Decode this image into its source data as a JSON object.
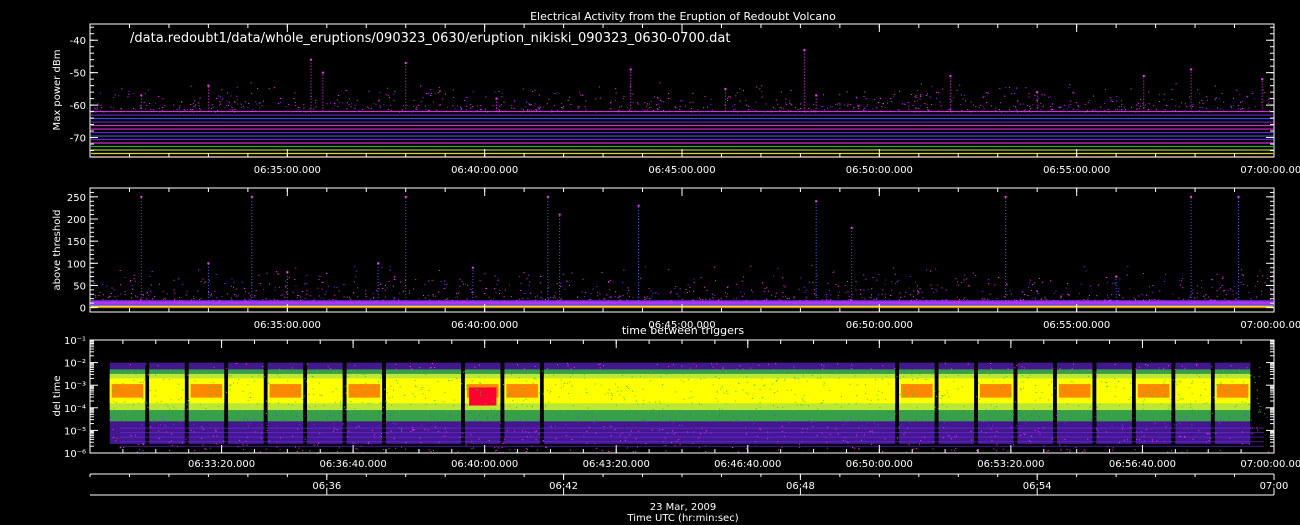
{
  "title": "Electrical Activity from the Eruption of Redoubt Volcano",
  "file_path": "/data.redoubt1/data/whole_eruptions/090323_0630/eruption_nikiski_090323_0630-0700.dat",
  "date_label": "23 Mar, 2009",
  "xaxis_title": "Time UTC (hr:min:sec)",
  "colors": {
    "background": "#000000",
    "axes": "#ffffff",
    "magenta": "#ff33ff",
    "purple": "#7a2cff",
    "blue": "#4466ff",
    "green": "#33cc33",
    "yellowgreen": "#ccee33",
    "yellow": "#ffff00",
    "orange": "#ff8800",
    "red": "#ff0033"
  },
  "chart_data": [
    {
      "type": "scatter",
      "title": "",
      "ylabel": "Max power dBm",
      "ylim": [
        -76,
        -35
      ],
      "y_ticks": [
        -40,
        -50,
        -60,
        -70
      ],
      "x_tick_labels": [
        "06:35:00.000",
        "06:40:00.000",
        "06:45:00.000",
        "06:50:00.000",
        "06:55:00.000",
        "07:00:00.000"
      ],
      "x_tick_minutes": [
        35,
        40,
        45,
        50,
        55,
        60
      ],
      "xlim_minutes": [
        30,
        60
      ],
      "baseline_range": [
        -76,
        -62
      ],
      "spikes": [
        {
          "t": 31.3,
          "y": -57
        },
        {
          "t": 33.0,
          "y": -54
        },
        {
          "t": 35.6,
          "y": -46
        },
        {
          "t": 35.9,
          "y": -50
        },
        {
          "t": 38.0,
          "y": -47
        },
        {
          "t": 40.3,
          "y": -58
        },
        {
          "t": 43.7,
          "y": -49
        },
        {
          "t": 46.1,
          "y": -55
        },
        {
          "t": 48.1,
          "y": -43
        },
        {
          "t": 48.4,
          "y": -57
        },
        {
          "t": 51.8,
          "y": -51
        },
        {
          "t": 54.0,
          "y": -56
        },
        {
          "t": 56.7,
          "y": -51
        },
        {
          "t": 57.9,
          "y": -49
        },
        {
          "t": 59.7,
          "y": -52
        }
      ]
    },
    {
      "type": "scatter",
      "ylabel": "above threshold",
      "ylim": [
        -10,
        270
      ],
      "y_ticks": [
        0,
        50,
        100,
        150,
        200,
        250
      ],
      "x_tick_labels": [
        "06:35:00.000",
        "06:40:00.000",
        "06:45:00.000",
        "06:50:00.000",
        "06:55:00.000",
        "07:00:00.000"
      ],
      "x_tick_minutes": [
        35,
        40,
        45,
        50,
        55,
        60
      ],
      "xlim_minutes": [
        30,
        60
      ],
      "baseline_range": [
        0,
        15
      ],
      "spikes": [
        {
          "t": 31.3,
          "y": 250
        },
        {
          "t": 33.0,
          "y": 100
        },
        {
          "t": 34.1,
          "y": 250
        },
        {
          "t": 35.0,
          "y": 80
        },
        {
          "t": 37.3,
          "y": 100
        },
        {
          "t": 38.0,
          "y": 250
        },
        {
          "t": 39.7,
          "y": 90
        },
        {
          "t": 41.6,
          "y": 250
        },
        {
          "t": 41.9,
          "y": 210
        },
        {
          "t": 43.9,
          "y": 230
        },
        {
          "t": 48.4,
          "y": 240
        },
        {
          "t": 49.3,
          "y": 180
        },
        {
          "t": 53.2,
          "y": 250
        },
        {
          "t": 56.0,
          "y": 70
        },
        {
          "t": 57.9,
          "y": 250
        },
        {
          "t": 59.1,
          "y": 250
        }
      ]
    },
    {
      "type": "scatter",
      "title": "time between triggers",
      "ylabel": "del time",
      "yscale": "log",
      "ylim": [
        1e-06,
        0.1
      ],
      "y_tick_labels": [
        "10⁻¹",
        "10⁻²",
        "10⁻³",
        "10⁻⁴",
        "10⁻⁵",
        "10⁻⁶"
      ],
      "y_tick_exponents": [
        -1,
        -2,
        -3,
        -4,
        -5,
        -6
      ],
      "x_tick_labels": [
        "06:33:20.000",
        "06:36:40.000",
        "06:40:00.000",
        "06:43:20.000",
        "06:46:40.000",
        "06:50:00.000",
        "06:53:20.000",
        "06:56:40.000",
        "07:00:00.000"
      ],
      "x_tick_minutes": [
        33.3333,
        36.6667,
        40.0,
        43.3333,
        46.6667,
        50.0,
        53.3333,
        56.6667,
        60.0
      ],
      "xlim_minutes": [
        30,
        60
      ],
      "blocks": [
        {
          "t0": 30.5,
          "t1": 31.4,
          "level": "orange"
        },
        {
          "t0": 31.5,
          "t1": 32.4,
          "level": "yellow"
        },
        {
          "t0": 32.5,
          "t1": 33.4,
          "level": "orange"
        },
        {
          "t0": 33.5,
          "t1": 34.4,
          "level": "yellow"
        },
        {
          "t0": 34.5,
          "t1": 35.4,
          "level": "orange"
        },
        {
          "t0": 35.5,
          "t1": 36.4,
          "level": "yellow"
        },
        {
          "t0": 36.5,
          "t1": 37.4,
          "level": "orange"
        },
        {
          "t0": 37.5,
          "t1": 39.4,
          "level": "yellow"
        },
        {
          "t0": 39.5,
          "t1": 40.4,
          "level": "red"
        },
        {
          "t0": 40.5,
          "t1": 41.4,
          "level": "orange"
        },
        {
          "t0": 41.5,
          "t1": 50.4,
          "level": "yellow"
        },
        {
          "t0": 50.5,
          "t1": 51.4,
          "level": "orange"
        },
        {
          "t0": 51.5,
          "t1": 52.4,
          "level": "yellow"
        },
        {
          "t0": 52.5,
          "t1": 53.4,
          "level": "orange"
        },
        {
          "t0": 53.5,
          "t1": 54.4,
          "level": "yellow"
        },
        {
          "t0": 54.5,
          "t1": 55.4,
          "level": "orange"
        },
        {
          "t0": 55.5,
          "t1": 56.4,
          "level": "yellow"
        },
        {
          "t0": 56.5,
          "t1": 57.4,
          "level": "orange"
        },
        {
          "t0": 57.5,
          "t1": 58.4,
          "level": "yellow"
        },
        {
          "t0": 58.5,
          "t1": 59.4,
          "level": "orange"
        }
      ]
    }
  ],
  "bottom_axis": {
    "tick_labels": [
      "06:36",
      "06:42",
      "06:48",
      "06:54",
      "07:00"
    ],
    "tick_minutes": [
      36,
      42,
      48,
      54,
      60
    ]
  }
}
